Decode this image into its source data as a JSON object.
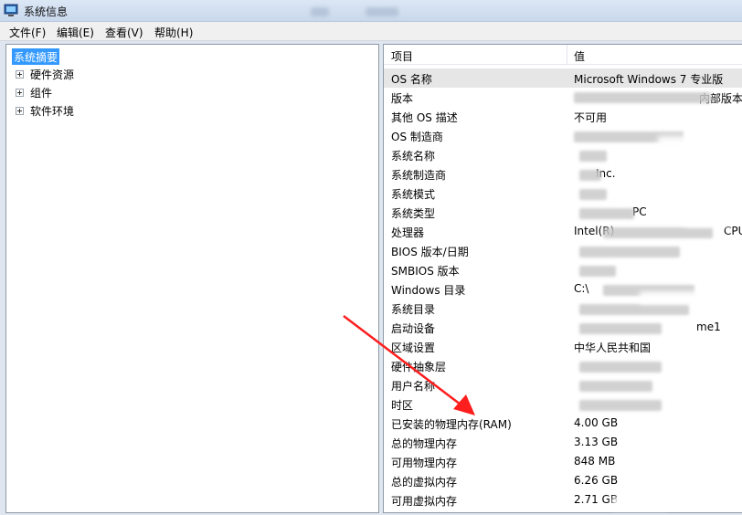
{
  "window": {
    "title": "系统信息"
  },
  "menu": [
    {
      "label": "文件(F)"
    },
    {
      "label": "编辑(E)"
    },
    {
      "label": "查看(V)"
    },
    {
      "label": "帮助(H)"
    }
  ],
  "tree": {
    "selected": "系统摘要",
    "children": [
      {
        "label": "硬件资源"
      },
      {
        "label": "组件"
      },
      {
        "label": "软件环境"
      }
    ]
  },
  "list": {
    "columns": {
      "item": "项目",
      "value": "值"
    },
    "rows": [
      {
        "item": "OS 名称",
        "value": "Microsoft Windows 7 专业版"
      },
      {
        "item": "版本",
        "value": "内部版本"
      },
      {
        "item": "其他 OS 描述",
        "value": "不可用"
      },
      {
        "item": "OS 制造商",
        "value": ""
      },
      {
        "item": "系统名称",
        "value": ""
      },
      {
        "item": "系统制造商",
        "value": "Inc."
      },
      {
        "item": "系统模式",
        "value": ""
      },
      {
        "item": "系统类型",
        "value": "PC"
      },
      {
        "item": "处理器",
        "value": "Intel(R)"
      },
      {
        "item": "BIOS 版本/日期",
        "value": ""
      },
      {
        "item": "SMBIOS 版本",
        "value": ""
      },
      {
        "item": "Windows 目录",
        "value": "C:\\"
      },
      {
        "item": "系统目录",
        "value": ""
      },
      {
        "item": "启动设备",
        "value": "me1"
      },
      {
        "item": "区域设置",
        "value": "中华人民共和国"
      },
      {
        "item": "硬件抽象层",
        "value": ""
      },
      {
        "item": "用户名称",
        "value": ""
      },
      {
        "item": "时区",
        "value": ""
      },
      {
        "item": "已安装的物理内存(RAM)",
        "value": "4.00 GB"
      },
      {
        "item": "总的物理内存",
        "value": "3.13 GB"
      },
      {
        "item": "可用物理内存",
        "value": "848 MB"
      },
      {
        "item": "总的虚拟内存",
        "value": "6.26 GB"
      },
      {
        "item": "可用虚拟内存",
        "value": "2.71 GB"
      }
    ],
    "cpu_suffix": "CPU"
  },
  "colors": {
    "selection": "#3399ff",
    "arrow": "#ff1e1e"
  }
}
